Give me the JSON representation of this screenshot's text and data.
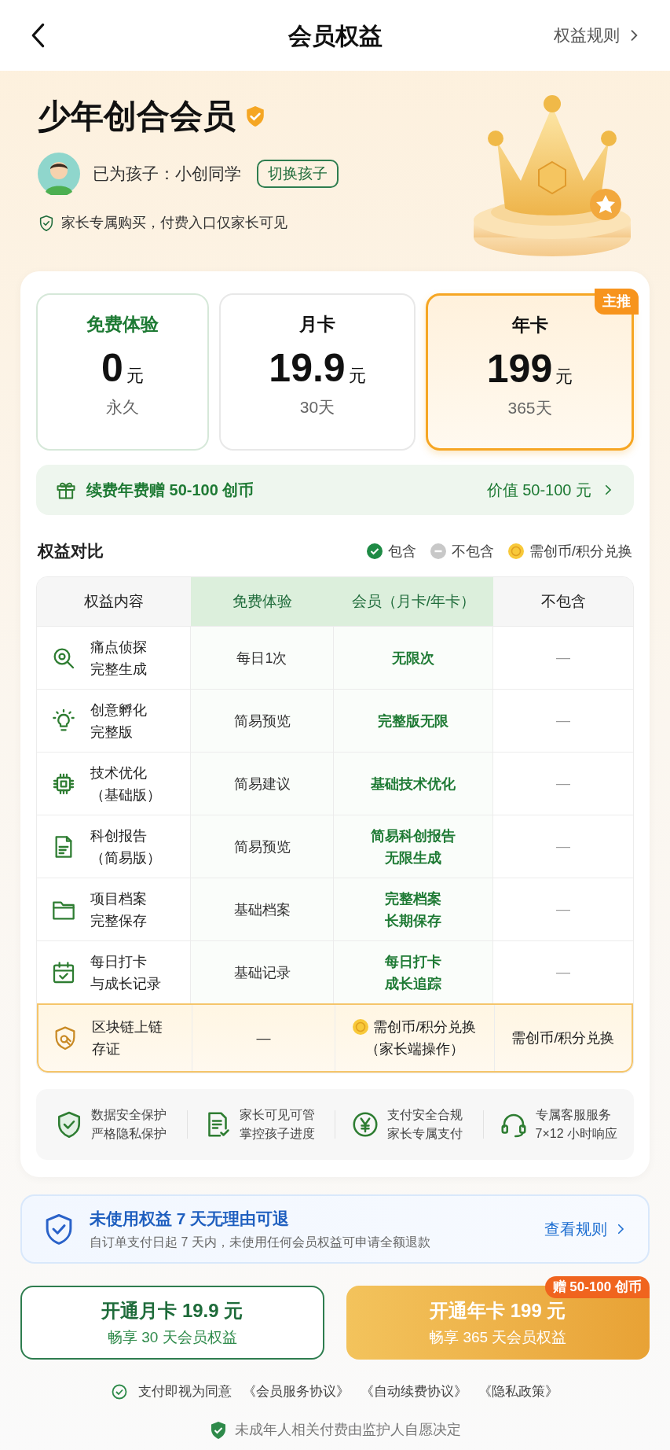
{
  "header": {
    "title": "会员权益",
    "rules_link": "权益规则"
  },
  "hero": {
    "title": "少年创合会员",
    "child_label": "已为孩子：小创同学",
    "switch_button": "切换孩子",
    "note": "家长专属购买，付费入口仅家长可见"
  },
  "plans": [
    {
      "kind": "free",
      "name": "免费体验",
      "price": "0",
      "unit": "元",
      "duration": "永久",
      "selected": false
    },
    {
      "kind": "paid",
      "name": "月卡",
      "price": "19.9",
      "unit": "元",
      "duration": "30天",
      "selected": false
    },
    {
      "kind": "paid",
      "name": "年卡",
      "price": "199",
      "unit": "元",
      "duration": "365天",
      "selected": true,
      "badge": "主推"
    }
  ],
  "gift_bar": {
    "text": "续费年费赠 50-100 创币",
    "value": "价值 50-100 元"
  },
  "comparison": {
    "title": "权益对比",
    "legend": [
      {
        "kind": "included",
        "label": "包含"
      },
      {
        "kind": "excluded",
        "label": "不包含"
      },
      {
        "kind": "coin",
        "label": "需创币/积分兑换"
      }
    ],
    "columns": [
      "权益内容",
      "免费体验",
      "会员（月卡/年卡）",
      "不包含"
    ],
    "rows": [
      {
        "kind": "standard",
        "feature": [
          "痛点侦探",
          "完整生成"
        ],
        "free": "每日1次",
        "member": [
          "无限次"
        ],
        "none": "—"
      },
      {
        "kind": "standard",
        "feature": [
          "创意孵化",
          "完整版"
        ],
        "free": "简易预览",
        "member": [
          "完整版无限"
        ],
        "none": "—"
      },
      {
        "kind": "standard",
        "feature": [
          "技术优化",
          "（基础版）"
        ],
        "free": "简易建议",
        "member": [
          "基础技术优化"
        ],
        "none": "—"
      },
      {
        "kind": "standard",
        "feature": [
          "科创报告",
          "（简易版）"
        ],
        "free": "简易预览",
        "member": [
          "简易科创报告",
          "无限生成"
        ],
        "none": "—"
      },
      {
        "kind": "standard",
        "feature": [
          "项目档案",
          "完整保存"
        ],
        "free": "基础档案",
        "member": [
          "完整档案",
          "长期保存"
        ],
        "none": "—"
      },
      {
        "kind": "standard",
        "feature": [
          "每日打卡",
          "与成长记录"
        ],
        "free": "基础记录",
        "member": [
          "每日打卡",
          "成长追踪"
        ],
        "none": "—"
      },
      {
        "kind": "exchange",
        "feature": [
          "区块链上链",
          "存证"
        ],
        "free": "—",
        "member": [
          "需创币/积分兑换",
          "（家长端操作）"
        ],
        "none": "需创币/积分兑换"
      }
    ]
  },
  "assurances": [
    {
      "line1": "数据安全保护",
      "line2": "严格隐私保护"
    },
    {
      "line1": "家长可见可管",
      "line2": "掌控孩子进度"
    },
    {
      "line1": "支付安全合规",
      "line2": "家长专属支付"
    },
    {
      "line1": "专属客服服务",
      "line2": "7×12 小时响应"
    }
  ],
  "refund": {
    "title": "未使用权益 7 天无理由可退",
    "subtitle": "自订单支付日起 7 天内，未使用任何会员权益可申请全额退款",
    "link": "查看规则"
  },
  "buttons": [
    {
      "kind": "outline",
      "title": "开通月卡 19.9 元",
      "subtitle": "畅享 30 天会员权益"
    },
    {
      "kind": "primary",
      "title": "开通年卡 199 元",
      "subtitle": "畅享 365 天会员权益",
      "badge": "赠 50-100 创币"
    }
  ],
  "agreement": {
    "checked": true,
    "text": "支付即视为同意",
    "links": [
      "《会员服务协议》",
      "《自动续费协议》",
      "《隐私政策》"
    ]
  },
  "footer_note": "未成年人相关付费由监护人自愿决定"
}
